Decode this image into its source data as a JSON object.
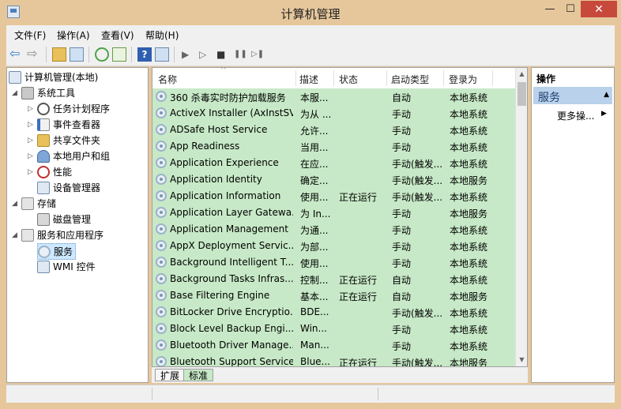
{
  "window": {
    "title": "计算机管理",
    "min_glyph": "—",
    "max_glyph": "☐",
    "close_glyph": "✕"
  },
  "menu": [
    "文件(F)",
    "操作(A)",
    "查看(V)",
    "帮助(H)"
  ],
  "toolbar": {
    "back_glyph": "⇦",
    "forward_glyph": "⇨",
    "help_glyph": "?",
    "play_glyph": "▶",
    "play2_glyph": "▷",
    "stop_glyph": "■",
    "pause_glyph": "❚❚",
    "restart_glyph": "▷❚"
  },
  "tree": {
    "root": "计算机管理(本地)",
    "system_tools": "系统工具",
    "task_scheduler": "任务计划程序",
    "event_viewer": "事件查看器",
    "shared_folders": "共享文件夹",
    "local_users": "本地用户和组",
    "performance": "性能",
    "device_manager": "设备管理器",
    "storage": "存储",
    "disk_management": "磁盘管理",
    "services_apps": "服务和应用程序",
    "services": "服务",
    "wmi": "WMI 控件",
    "expanded_glyph": "◢",
    "collapsed_glyph": "▷"
  },
  "list": {
    "columns": [
      "名称",
      "描述",
      "状态",
      "启动类型",
      "登录为"
    ],
    "sort_glyph": "^",
    "rows": [
      {
        "name": "360 杀毒实时防护加载服务",
        "desc": "本服...",
        "status": "",
        "startup": "自动",
        "logon": "本地系统"
      },
      {
        "name": "ActiveX Installer (AxInstSV)",
        "desc": "为从 ...",
        "status": "",
        "startup": "手动",
        "logon": "本地系统"
      },
      {
        "name": "ADSafe Host Service",
        "desc": "允许...",
        "status": "",
        "startup": "手动",
        "logon": "本地系统"
      },
      {
        "name": "App Readiness",
        "desc": "当用...",
        "status": "",
        "startup": "手动",
        "logon": "本地系统"
      },
      {
        "name": "Application Experience",
        "desc": "在应...",
        "status": "",
        "startup": "手动(触发...",
        "logon": "本地系统"
      },
      {
        "name": "Application Identity",
        "desc": "确定...",
        "status": "",
        "startup": "手动(触发...",
        "logon": "本地服务"
      },
      {
        "name": "Application Information",
        "desc": "使用...",
        "status": "正在运行",
        "startup": "手动(触发...",
        "logon": "本地系统"
      },
      {
        "name": "Application Layer Gatewa...",
        "desc": "为 In...",
        "status": "",
        "startup": "手动",
        "logon": "本地服务"
      },
      {
        "name": "Application Management",
        "desc": "为通...",
        "status": "",
        "startup": "手动",
        "logon": "本地系统"
      },
      {
        "name": "AppX Deployment Servic...",
        "desc": "为部...",
        "status": "",
        "startup": "手动",
        "logon": "本地系统"
      },
      {
        "name": "Background Intelligent T...",
        "desc": "使用...",
        "status": "",
        "startup": "手动",
        "logon": "本地系统"
      },
      {
        "name": "Background Tasks Infras...",
        "desc": "控制...",
        "status": "正在运行",
        "startup": "自动",
        "logon": "本地系统"
      },
      {
        "name": "Base Filtering Engine",
        "desc": "基本...",
        "status": "正在运行",
        "startup": "自动",
        "logon": "本地服务"
      },
      {
        "name": "BitLocker Drive Encryptio...",
        "desc": "BDE...",
        "status": "",
        "startup": "手动(触发...",
        "logon": "本地系统"
      },
      {
        "name": "Block Level Backup Engi...",
        "desc": "Win...",
        "status": "",
        "startup": "手动",
        "logon": "本地系统"
      },
      {
        "name": "Bluetooth Driver Manage...",
        "desc": "Man...",
        "status": "",
        "startup": "手动",
        "logon": "本地系统"
      },
      {
        "name": "Bluetooth Support Service",
        "desc": "Blue...",
        "status": "正在运行",
        "startup": "手动(触发...",
        "logon": "本地服务"
      }
    ],
    "scroll_up_glyph": "▲",
    "scroll_down_glyph": "▼"
  },
  "tabs": [
    "扩展",
    "标准"
  ],
  "actions": {
    "title": "操作",
    "section": "服务",
    "collapse_glyph": "▲",
    "more": "更多操...",
    "more_arrow": "▶"
  },
  "colors": {
    "frame": "#e6c79c",
    "row_highlight": "#c7e9c7",
    "section_header": "#b9d1ea",
    "close_button": "#c7493c"
  }
}
